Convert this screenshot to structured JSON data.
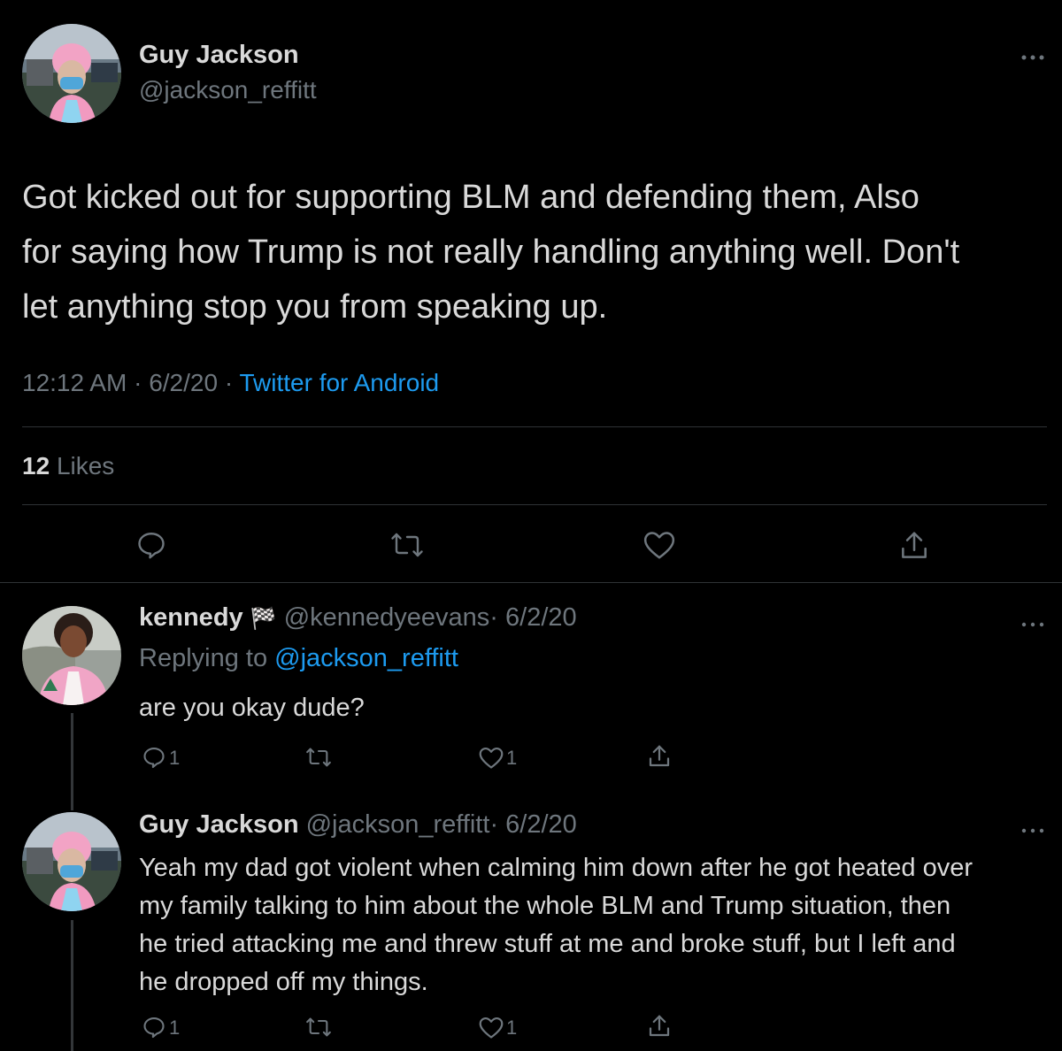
{
  "main_tweet": {
    "display_name": "Guy Jackson",
    "handle": "@jackson_reffitt",
    "text_lines": [
      "Got kicked out for supporting BLM and defending them, Also",
      "for saying how Trump is not really handling anything well. Don't",
      "let anything stop you from speaking up."
    ],
    "time": "12:12 AM",
    "sep": "·",
    "date": "6/2/20",
    "source": "Twitter for Android",
    "likes_count": "12",
    "likes_label": "Likes",
    "more_icon": "more-horizontal-icon"
  },
  "replies": [
    {
      "display_name": "kennedy",
      "flag_emoji": "🏁",
      "handle": "@kennedyeevans",
      "date": "· 6/2/20",
      "replying_prefix": "Replying to",
      "replying_handle": "@jackson_reffitt",
      "text_lines": [
        "are you okay dude?"
      ],
      "reply_count": "1",
      "like_count": "1"
    },
    {
      "display_name": "Guy Jackson",
      "handle": "@jackson_reffitt",
      "date": "· 6/2/20",
      "text_lines": [
        "Yeah my dad got violent when calming him down after he got heated over",
        "my family talking to him about the whole BLM and Trump situation, then",
        "he tried attacking me and threw stuff at me and broke stuff, but I left and",
        "he dropped off my things."
      ],
      "reply_count": "1",
      "like_count": "1"
    }
  ],
  "colors": {
    "background": "#000000",
    "text": "#d9d9d9",
    "muted": "#6e767d",
    "link": "#1d9bf0",
    "divider": "#2f3336"
  }
}
